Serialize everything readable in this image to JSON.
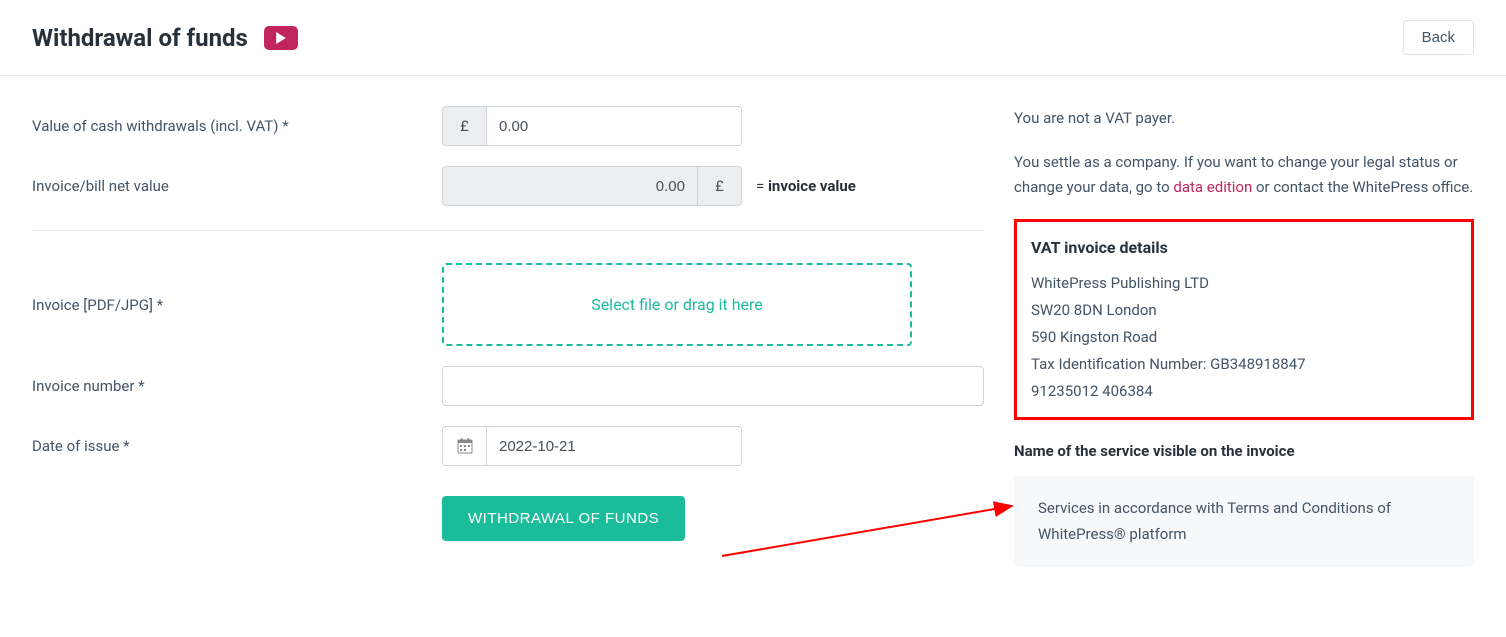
{
  "header": {
    "title": "Withdrawal of funds",
    "back_label": "Back"
  },
  "form": {
    "value_label": "Value of cash withdrawals (incl. VAT) *",
    "currency_symbol": "£",
    "value_amount": "0.00",
    "net_label": "Invoice/bill net value",
    "net_amount": "0.00",
    "invoice_hint_prefix": "= ",
    "invoice_hint_strong": "invoice value",
    "file_label": "Invoice [PDF/JPG] *",
    "file_drop_text": "Select file or drag it here",
    "invoice_number_label": "Invoice number *",
    "invoice_number_value": "",
    "date_label": "Date of issue *",
    "date_value": "2022-10-21",
    "submit_label": "WITHDRAWAL OF FUNDS"
  },
  "sidebar": {
    "vat_payer_text": "You are not a VAT payer.",
    "company_text_1": "You settle as a company. If you want to change your legal status or change your data, go to ",
    "company_link": "data edition",
    "company_text_2": " or contact the WhitePress office.",
    "vat_details_title": "VAT invoice details",
    "vat_company": "WhitePress Publishing LTD",
    "vat_address1": "SW20 8DN London",
    "vat_address2": "590 Kingston Road",
    "vat_tin": "Tax Identification Number: GB348918847",
    "vat_extra": "91235012 406384",
    "service_title": "Name of the service visible on the invoice",
    "service_text": "Services in accordance with Terms and Conditions of WhitePress® platform"
  }
}
